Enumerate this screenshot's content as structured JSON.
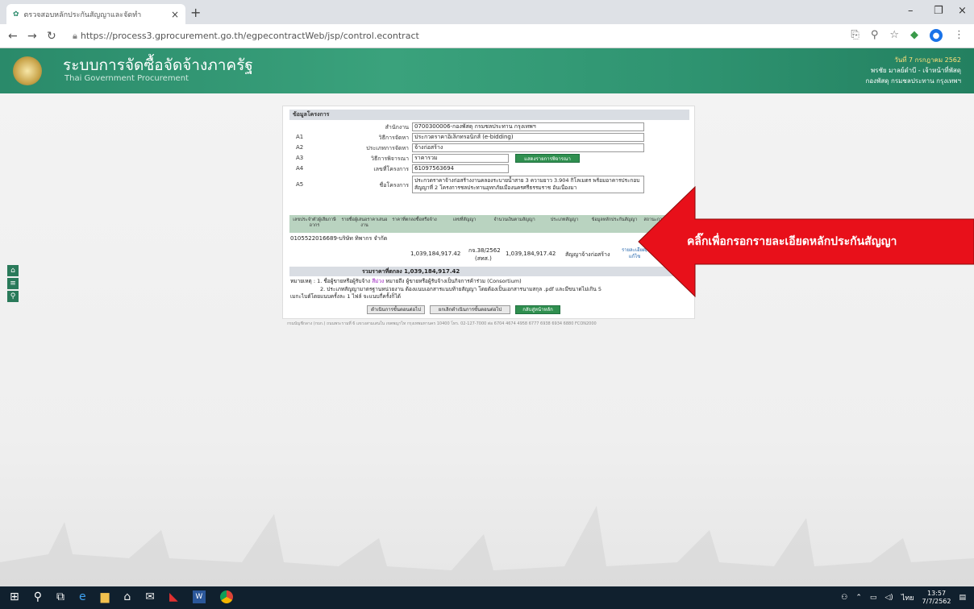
{
  "browser": {
    "tab_title": "ตรวจสอบหลักประกันสัญญาและจัดทำ",
    "tab_close": "×",
    "new_tab": "+",
    "url": "https://process3.gprocurement.go.th/egpecontractWeb/jsp/control.econtract",
    "window_controls": {
      "minimize": "–",
      "restore": "❐",
      "close": "×"
    }
  },
  "site": {
    "title": "ระบบการจัดซื้อจัดจ้างภาครัฐ",
    "subtitle": "Thai Government Procurement",
    "user_line1": "วันที่ 7 กรกฎาคม 2562",
    "user_line2": "พรชัย มาลย์ดำบี - เจ้าหน้าที่พัสดุ",
    "user_line3": "กองพัสดุ กรมชลประทาน กรุงเทพฯ"
  },
  "side_tools": {
    "home": "⌂",
    "menu": "≡",
    "search": "⚲"
  },
  "project": {
    "header": "ข้อมูลโครงการ",
    "agency_label": "สำนักงาน",
    "agency_value": "0700300006-กองพัสดุ กรมชลประทาน กรุงเทพฯ",
    "a1_code": "A1",
    "a1_label": "วิธีการจัดหา",
    "a1_value": "ประกวดราคาอิเล็กทรอนิกส์ (e-bidding)",
    "a2_code": "A2",
    "a2_label": "ประเภทการจัดหา",
    "a2_value": "จ้างก่อสร้าง",
    "a3_code": "A3",
    "a3_label": "วิธีการพิจารณา",
    "a3_value": "ราคารวม",
    "a3_button": "แสดงรายการพิจารณา",
    "a4_code": "A4",
    "a4_label": "เลขที่โครงการ",
    "a4_value": "61097563694",
    "a5_code": "A5",
    "a5_label": "ชื่อโครงการ",
    "a5_value": "ประกวดราคาจ้างก่อสร้างงานคลองระบายน้ำสาย 3 ความยาว 3.904 กิโลเมตร พร้อมอาคารประกอบ สัญญาที่ 2 โครงการชลประทานอุทกภัยเมืองนครศรีธรรมราช อันเนื่องมา"
  },
  "table": {
    "headers": [
      "เลขประจำตัวผู้เสียภาษีอากร",
      "รายชื่อผู้เสนอราคาเสนองาน",
      "ราคาที่ตกลงซื้อหรือจ้าง",
      "เลขที่สัญญา",
      "จำนวนเงินตามสัญญา",
      "ประเภทสัญญา",
      "ข้อมูลหลักประกันสัญญา",
      "สถานะการดำเนินการ"
    ],
    "company": "0105522016689-บริษัท ทิพากร จำกัด",
    "price": "1,039,184,917.42",
    "contract_no": "กจ.38/2562",
    "contract_no_sub": "(สทส.)",
    "contract_amount": "1,039,184,917.42",
    "contract_type": "สัญญาจ้างก่อสร้าง",
    "link_text": "รายละเอียด/แก้ไข",
    "total": "รวมราคาที่ตกลง 1,039,184,917.42"
  },
  "remarks": {
    "r1_prefix": "หมายเหตุ : 1. ชื่อผู้ขายหรือผู้รับจ้าง",
    "r1_highlight": "สีม่วง",
    "r1_suffix": "หมายถึง ผู้ขายหรือผู้รับจ้างเป็นกิจการค้าร่วม (Consortium)",
    "r2": "2. ประเภทสัญญามาตรฐานหน่วยงาน ต้องแนบเอกสารแนบท้ายสัญญา โดยต้องเป็นเอกสารนามสกุล .pdf และมีขนาดไม่เกิน 5",
    "r3": "เมกะไบต์โดยแนบครั้งละ 1 ไฟล์ จะแนบกี่ครั้งก็ได้"
  },
  "buttons": {
    "next_step": "ดำเนินการขั้นตอนต่อไป",
    "cancel_step": "ยกเลิกดำเนินการขั้นตอนต่อไป",
    "back": "กลับสู่หน้าหลัก"
  },
  "footer": "กรมบัญชีกลาง (กบก.) ถนนพระรามที่ 6 แขวงสามเสนใน เขตพญาไท กรุงเทพมหานคร 10400 โทร. 02-127-7000 ต่อ 6704 4674 4958 6777 6938 6934 6880 FCON2000",
  "annotation": {
    "text": "คลิ๊กเพื่อกรอกรายละเอียดหลักประกันสัญญา",
    "color": "#e8101a"
  },
  "taskbar": {
    "time": "13:57",
    "date": "7/7/2562",
    "lang": "ไทย"
  }
}
